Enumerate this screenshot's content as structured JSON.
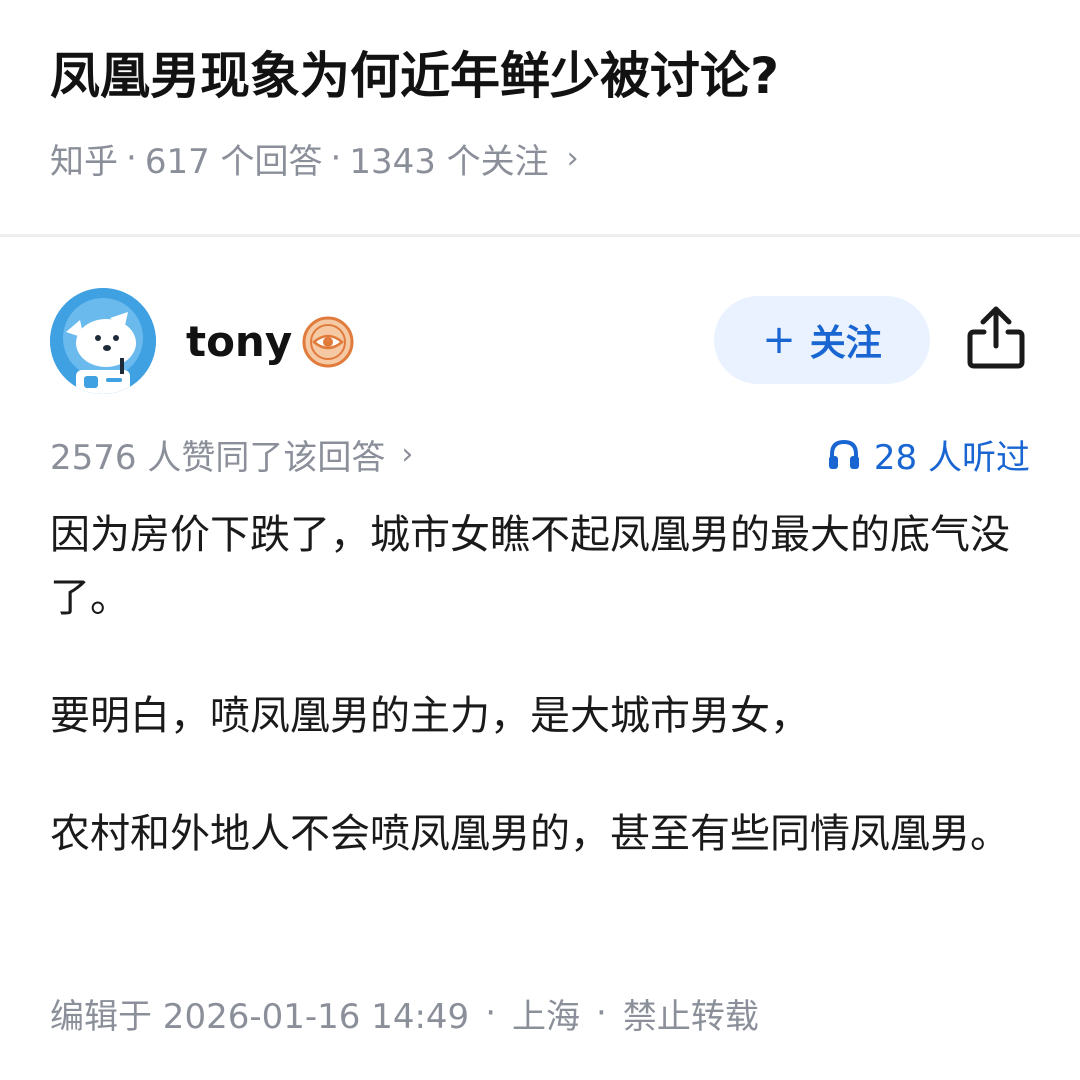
{
  "question": {
    "title": "凤凰男现象为何近年鲜少被讨论?",
    "source": "知乎",
    "answers": "617 个回答",
    "followers": "1343 个关注"
  },
  "author": {
    "name": "tony",
    "avatar_icon": "dog-astronaut-avatar",
    "badge_icon": "eye-badge-icon",
    "follow_label": "关注",
    "share_icon": "share-icon"
  },
  "stats": {
    "likes_text": "2576 人赞同了该回答",
    "listen_text": "28 人听过"
  },
  "content": {
    "paragraphs": [
      "因为房价下跌了，城市女瞧不起凤凰男的最大的底气没了。",
      "要明白，喷凤凰男的主力，是大城市男女，",
      "农村和外地人不会喷凤凰男的，甚至有些同情凤凰男。"
    ]
  },
  "footer": {
    "edited": "编辑于 2026-01-16 14:49",
    "location": "上海",
    "rights": "禁止转载"
  },
  "colors": {
    "accent": "#1966d2",
    "follow_bg": "#e9f2fe",
    "muted": "#8a8f99",
    "avatar_bg": "#3fa0e2",
    "badge": "#e07b3c"
  }
}
